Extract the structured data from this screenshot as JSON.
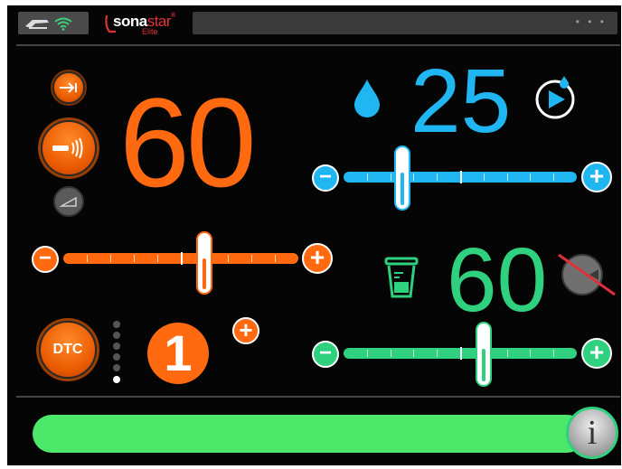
{
  "header": {
    "logo_brand_main": "sona",
    "logo_brand_accent": "star",
    "logo_reg": "®",
    "logo_sub": "Elite",
    "menu_dots": "• • •"
  },
  "power": {
    "value": "60",
    "slider_level": 0.6,
    "minus_label": "−",
    "plus_label": "+",
    "color": "#ff6a10"
  },
  "dtc": {
    "label": "DTC",
    "value": "1",
    "plus_label": "+",
    "active_indicator": 1
  },
  "irrigation": {
    "value": "25",
    "slider_level": 0.25,
    "minus_label": "−",
    "plus_label": "+",
    "color": "#1fb6f2"
  },
  "aspiration": {
    "value": "60",
    "slider_level": 0.6,
    "minus_label": "−",
    "plus_label": "+",
    "color": "#2fd17e"
  },
  "footer": {
    "info_label": "i",
    "bar_color": "#4ce86a"
  },
  "icons": {
    "status": [
      "handpiece-icon",
      "wifi-icon"
    ],
    "power": [
      "arrow-right-to-line-icon",
      "ultrasound-emitter-icon",
      "tip-icon"
    ],
    "irrigation": [
      "water-drop-icon",
      "drop-play-icon"
    ],
    "aspiration": [
      "canister-icon",
      "suction-disabled-icon"
    ],
    "footer": [
      "info-icon"
    ]
  }
}
